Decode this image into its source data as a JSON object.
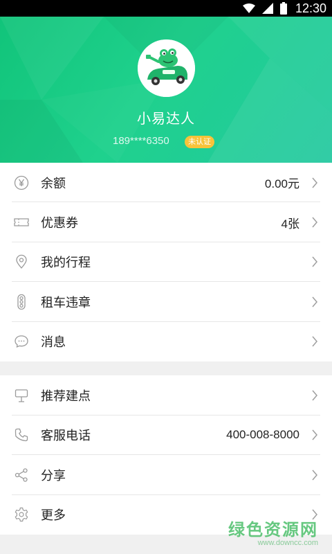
{
  "status_bar": {
    "time": "12:30",
    "icons": [
      "wifi-icon",
      "signal-icon",
      "battery-icon"
    ]
  },
  "profile": {
    "name": "小易达人",
    "phone": "189****6350",
    "verify_badge": "未认证",
    "colors": {
      "header_start": "#11c47a",
      "header_end": "#23c9a0",
      "badge": "#f8c33a"
    }
  },
  "menu_group_1": [
    {
      "icon": "yuan-icon",
      "label": "余额",
      "value": "0.00元"
    },
    {
      "icon": "ticket-icon",
      "label": "优惠券",
      "value": "4张"
    },
    {
      "icon": "location-pin-icon",
      "label": "我的行程",
      "value": ""
    },
    {
      "icon": "traffic-light-icon",
      "label": "租车违章",
      "value": ""
    },
    {
      "icon": "chat-bubble-icon",
      "label": "消息",
      "value": ""
    }
  ],
  "menu_group_2": [
    {
      "icon": "signpost-icon",
      "label": "推荐建点",
      "value": ""
    },
    {
      "icon": "phone-icon",
      "label": "客服电话",
      "value": "400-008-8000"
    },
    {
      "icon": "share-icon",
      "label": "分享",
      "value": ""
    },
    {
      "icon": "gear-icon",
      "label": "更多",
      "value": ""
    }
  ],
  "watermark": {
    "main": "绿色资源网",
    "url": "www.downcc.com"
  }
}
